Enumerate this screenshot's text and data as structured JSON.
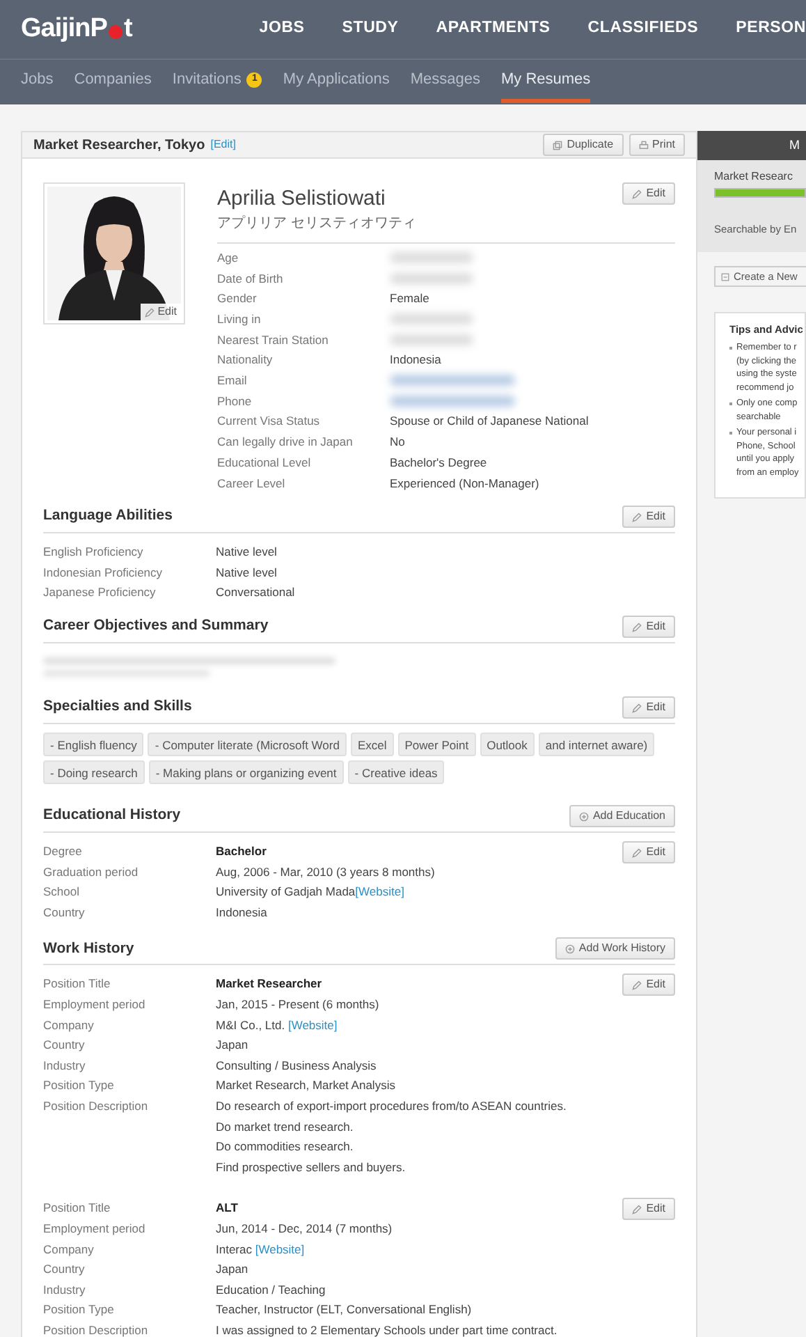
{
  "header": {
    "logo": [
      "GaijinP",
      "t"
    ],
    "nav": [
      "JOBS",
      "STUDY",
      "APARTMENTS",
      "CLASSIFIEDS",
      "PERSON"
    ]
  },
  "subnav": [
    {
      "label": "Jobs",
      "selected": false
    },
    {
      "label": "Companies",
      "selected": false
    },
    {
      "label": "Invitations",
      "badge": "1",
      "selected": false
    },
    {
      "label": "My Applications",
      "selected": false
    },
    {
      "label": "Messages",
      "selected": false
    },
    {
      "label": "My Resumes",
      "selected": true
    }
  ],
  "resume": {
    "title": "Market Researcher, Tokyo",
    "edit_link": "[Edit]",
    "actions": [
      "Duplicate",
      "Print"
    ],
    "profile": {
      "photo_edit": "Edit",
      "name": "Aprilia Selistiowati",
      "name_kana": "アプリリア セリスティオワティ",
      "edit": "Edit",
      "fields": [
        {
          "label": "Age",
          "blurred": true
        },
        {
          "label": "Date of Birth",
          "blurred": true
        },
        {
          "label": "Gender",
          "value": "Female",
          "blurred": false
        },
        {
          "label": "Living in",
          "blurred": true
        },
        {
          "label": "Nearest Train Station",
          "blurred": true
        },
        {
          "label": "Nationality",
          "value": "Indonesia",
          "blurred": false
        },
        {
          "label": "Email",
          "blurred": true
        },
        {
          "label": "Phone",
          "blurred": true
        },
        {
          "label": "Current Visa Status",
          "value": "Spouse or Child of Japanese National",
          "blurred": false
        },
        {
          "label": "Can legally drive in Japan",
          "value": "No",
          "blurred": false
        },
        {
          "label": "Educational Level",
          "value": "Bachelor's Degree",
          "blurred": false
        },
        {
          "label": "Career Level",
          "value": "Experienced (Non-Manager)",
          "blurred": false
        }
      ]
    },
    "languages": {
      "heading": "Language Abilities",
      "edit": "Edit",
      "rows": [
        {
          "label": "English Proficiency",
          "value": "Native level"
        },
        {
          "label": "Indonesian Proficiency",
          "value": "Native level"
        },
        {
          "label": "Japanese Proficiency",
          "value": "Conversational"
        }
      ]
    },
    "career": {
      "heading": "Career Objectives and Summary",
      "edit": "Edit",
      "blurred": true
    },
    "skills": {
      "heading": "Specialties and Skills",
      "edit": "Edit",
      "tags": [
        "- English fluency",
        "- Computer literate (Microsoft Word",
        "Excel",
        "Power Point",
        "Outlook",
        "and internet aware)",
        "- Doing research",
        "- Making plans or organizing event",
        "- Creative ideas"
      ]
    },
    "education": {
      "heading": "Educational History",
      "add": "Add Education",
      "entries": [
        {
          "edit": "Edit",
          "rows": [
            {
              "label": "Degree",
              "value": "Bachelor",
              "kind": "title"
            },
            {
              "label": "Graduation period",
              "value": "Aug, 2006 - Mar, 2010 (3 years 8 months)",
              "kind": "text"
            },
            {
              "label": "School",
              "value": "University of Gadjah Mada",
              "link": "[Website]",
              "kind": "link"
            },
            {
              "label": "Country",
              "value": "Indonesia",
              "kind": "text"
            }
          ]
        }
      ]
    },
    "work": {
      "heading": "Work History",
      "add": "Add Work History",
      "entries": [
        {
          "edit": "Edit",
          "rows": [
            {
              "label": "Position Title",
              "value": "Market Researcher",
              "kind": "title"
            },
            {
              "label": "Employment period",
              "value": "Jan, 2015 - Present (6 months)",
              "kind": "text"
            },
            {
              "label": "Company",
              "value": "M&I Co., Ltd. ",
              "link": "[Website]",
              "kind": "link"
            },
            {
              "label": "Country",
              "value": "Japan",
              "kind": "text"
            },
            {
              "label": "Industry",
              "value": "Consulting / Business Analysis",
              "kind": "text"
            },
            {
              "label": "Position Type",
              "value": "Market Research, Market Analysis",
              "kind": "text"
            },
            {
              "label": "Position Description",
              "lines": [
                "Do research of export-import procedures from/to ASEAN countries.",
                "Do market trend research.",
                "Do commodities research.",
                "Find prospective sellers and buyers."
              ],
              "kind": "lines"
            }
          ]
        },
        {
          "edit": "Edit",
          "rows": [
            {
              "label": "Position Title",
              "value": "ALT",
              "kind": "title"
            },
            {
              "label": "Employment period",
              "value": "Jun, 2014 - Dec, 2014 (7 months)",
              "kind": "text"
            },
            {
              "label": "Company",
              "value": "Interac ",
              "link": "[Website]",
              "kind": "link"
            },
            {
              "label": "Country",
              "value": "Japan",
              "kind": "text"
            },
            {
              "label": "Industry",
              "value": "Education / Teaching",
              "kind": "text"
            },
            {
              "label": "Position Type",
              "value": "Teacher, Instructor (ELT, Conversational English)",
              "kind": "text"
            },
            {
              "label": "Position Description",
              "lines": [
                "I was assigned to 2 Elementary Schools under part time contract."
              ],
              "kind": "lines"
            }
          ]
        }
      ]
    }
  },
  "sidebar": {
    "header": "M",
    "resume_name": "Market Researc",
    "level": 1,
    "searchable": "Searchable by En",
    "create": "Create a New",
    "tips_title": "Tips and Advic",
    "tips": [
      [
        "Remember to r",
        "(by clicking the",
        "using the syste",
        "recommend jo"
      ],
      [
        "Only one comp",
        "searchable"
      ],
      [
        "Your personal i",
        "Phone, School",
        "until you apply",
        "from an employ"
      ]
    ]
  }
}
